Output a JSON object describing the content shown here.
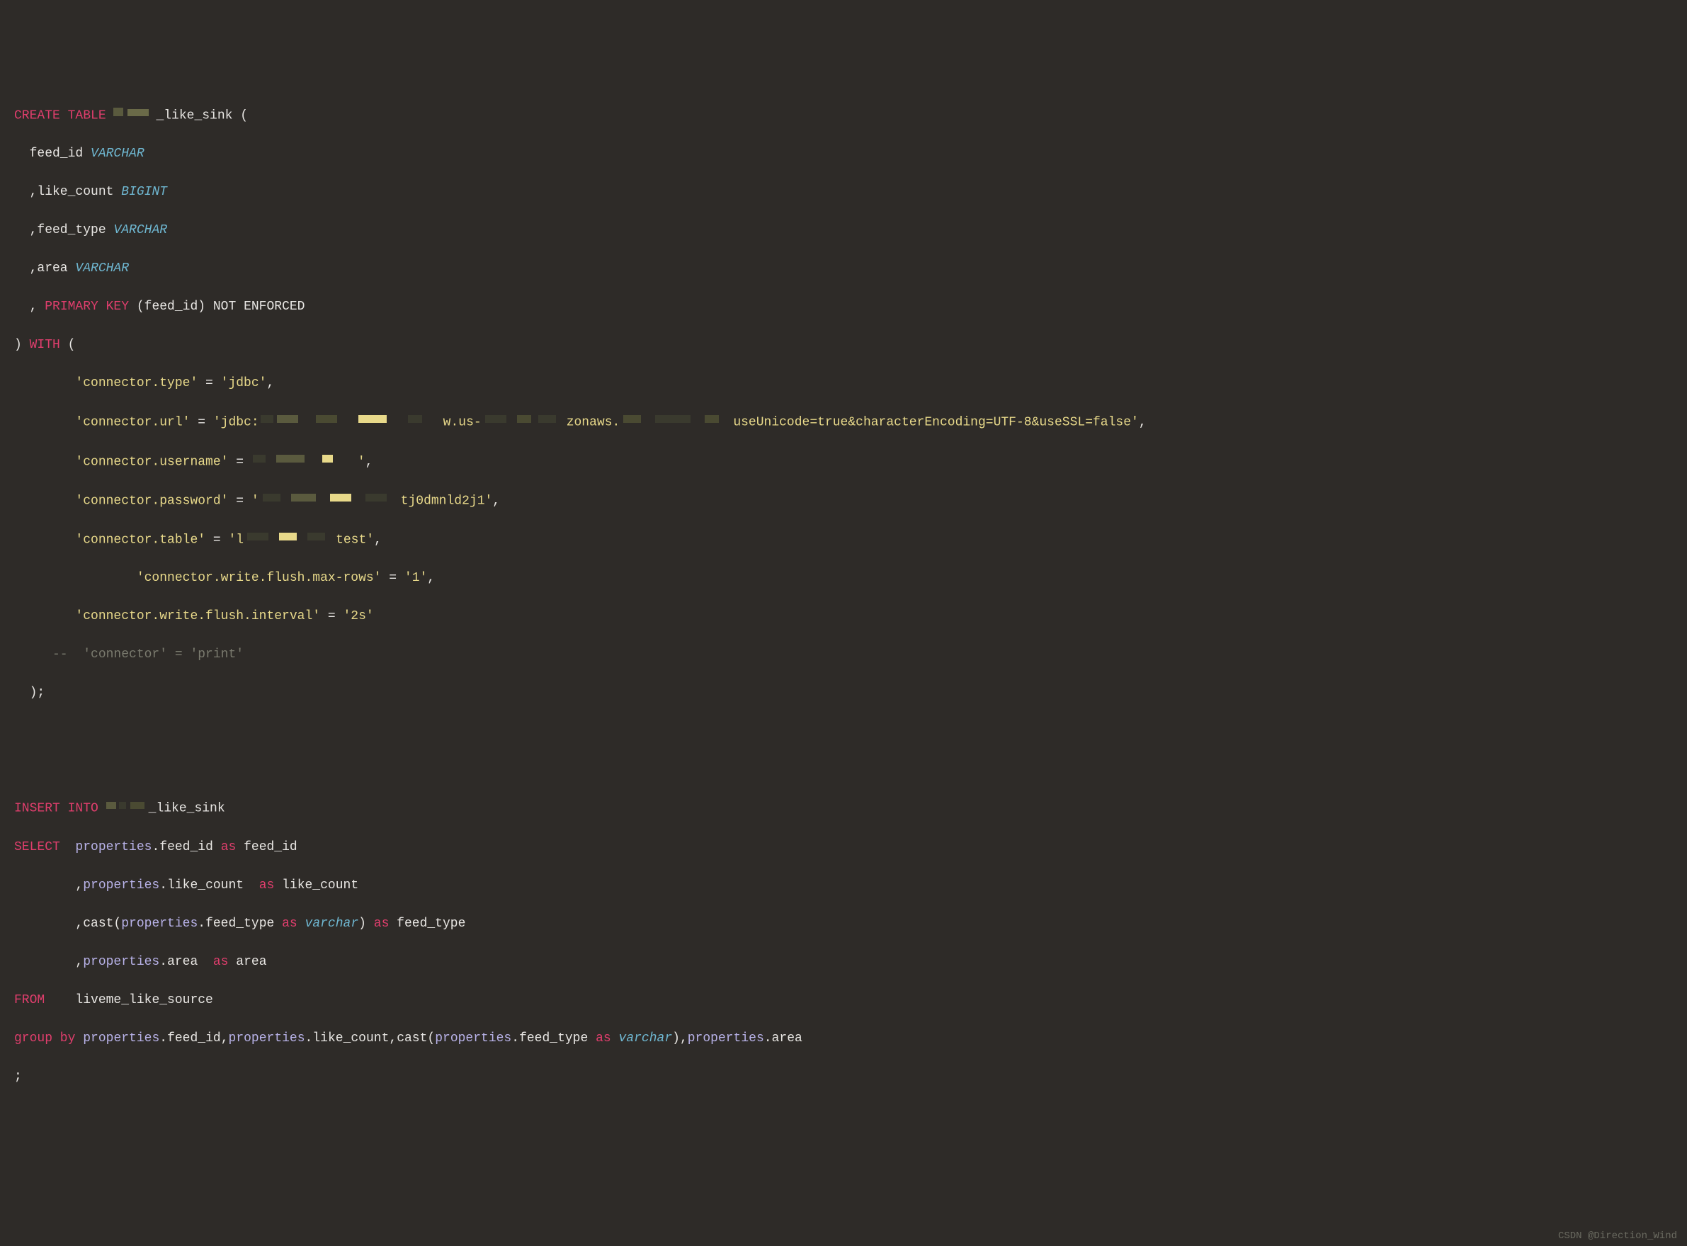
{
  "code": {
    "l1_create": "CREATE TABLE",
    "l1_name": "_like_sink (",
    "l2_col": "  feed_id ",
    "l2_type": "VARCHAR",
    "l3_col": "  ,like_count ",
    "l3_type": "BIGINT",
    "l4_col": "  ,feed_type ",
    "l4_type": "VARCHAR",
    "l5_col": "  ,area ",
    "l5_type": "VARCHAR",
    "l6_comma": "  , ",
    "l6_pk": "PRIMARY KEY",
    "l6_rest": " (feed_id) NOT ENFORCED",
    "l7_paren": ") ",
    "l7_with": "WITH",
    "l7_open": " (",
    "l8_key": "        'connector.type'",
    "l8_eq": " = ",
    "l8_val": "'jdbc'",
    "l8_comma": ",",
    "l9_key": "        'connector.url'",
    "l9_eq": " = ",
    "l9_val_a": "'jdbc:",
    "l9_val_b": "w.us-",
    "l9_val_c": "zonaws.",
    "l9_val_d": "useUnicode=true&characterEncoding=UTF-8&useSSL=false'",
    "l9_comma": ",",
    "l10_key": "        'connector.username'",
    "l10_eq": " = ",
    "l10_val": "'",
    "l10_comma": ",",
    "l11_key": "        'connector.password'",
    "l11_eq": " = ",
    "l11_val_a": "'",
    "l11_val_b": "tj0dmnld2j1'",
    "l11_comma": ",",
    "l12_key": "        'connector.table'",
    "l12_eq": " = ",
    "l12_val_a": "'l",
    "l12_val_b": "test'",
    "l12_comma": ",",
    "l13_key": "                'connector.write.flush.max-rows'",
    "l13_eq": " = ",
    "l13_val": "'1'",
    "l13_comma": ",",
    "l14_key": "        'connector.write.flush.interval'",
    "l14_eq": " = ",
    "l14_val": "'2s'",
    "l15_comment": "     --  'connector' = 'print'",
    "l16_close": "  );",
    "l18_ins": "INSERT INTO",
    "l18_name": "_like_sink",
    "l19_sel": "SELECT",
    "l19_sp": "  ",
    "l19_a": "properties",
    "l19_dot": ".",
    "l19_b": "feed_id ",
    "l19_as": "as",
    "l19_c": " feed_id",
    "l20_sp": "        ,",
    "l20_a": "properties",
    "l20_dot": ".",
    "l20_b": "like_count  ",
    "l20_as": "as",
    "l20_c": " like_count",
    "l21_sp": "        ,",
    "l21_cast": "cast(",
    "l21_a": "properties",
    "l21_dot": ".",
    "l21_b": "feed_type ",
    "l21_as1": "as",
    "l21_sp2": " ",
    "l21_vc": "varchar",
    "l21_cp": ") ",
    "l21_as2": "as",
    "l21_c": " feed_type",
    "l22_sp": "        ,",
    "l22_a": "properties",
    "l22_dot": ".",
    "l22_b": "area  ",
    "l22_as": "as",
    "l22_c": " area",
    "l23_from": "FROM",
    "l23_tbl": "    liveme_like_source",
    "l24_gb": "group by",
    "l24_sp": " ",
    "l24_a": "properties",
    "l24_d1": ".",
    "l24_b": "feed_id",
    "l24_c1": ",",
    "l24_c": "properties",
    "l24_d2": ".",
    "l24_d": "like_count",
    "l24_c2": ",",
    "l24_cast": "cast(",
    "l24_e": "properties",
    "l24_d3": ".",
    "l24_f": "feed_type ",
    "l24_as": "as",
    "l24_sp2": " ",
    "l24_vc": "varchar",
    "l24_cp": "),",
    "l24_g": "properties",
    "l24_d4": ".",
    "l24_h": "area",
    "l25_semi": ";"
  },
  "watermark": "CSDN @Direction_Wind"
}
